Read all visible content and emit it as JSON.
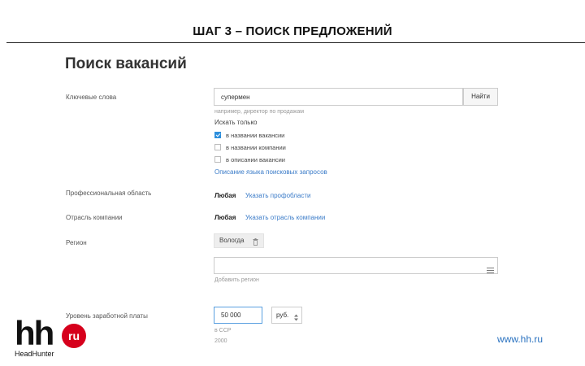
{
  "slide": {
    "title": "ШАГ 3 – ПОИСК ПРЕДЛОЖЕНИЙ",
    "site": "www.hh.ru"
  },
  "logo": {
    "main": "hh",
    "badge": "ru",
    "sub": "HeadHunter"
  },
  "page": {
    "title": "Поиск вакансий"
  },
  "keywords": {
    "label": "Ключевые слова",
    "value": "супермен",
    "button": "Найти",
    "hint": "например, директор по продажам",
    "search_only": "Искать только",
    "options": [
      {
        "label": "в названии вакансии",
        "checked": true
      },
      {
        "label": "в названии компании",
        "checked": false
      },
      {
        "label": "в описании вакансии",
        "checked": false
      }
    ],
    "syntax_link": "Описание языка поисковых запросов"
  },
  "profarea": {
    "label": "Профессиональная область",
    "value": "Любая",
    "link": "Указать профобласти"
  },
  "industry": {
    "label": "Отрасль компании",
    "value": "Любая",
    "link": "Указать отрасль компании"
  },
  "region": {
    "label": "Регион",
    "tag": "Вологда",
    "add_hint": "Добавить регион"
  },
  "salary": {
    "label": "Уровень заработной платы",
    "value": "50 000",
    "currency": "руб.",
    "hint1": "в ССР",
    "hint2": "2000"
  },
  "icons": {
    "remove": "trash-icon",
    "list": "list-icon",
    "spinner": "updown-icon"
  }
}
